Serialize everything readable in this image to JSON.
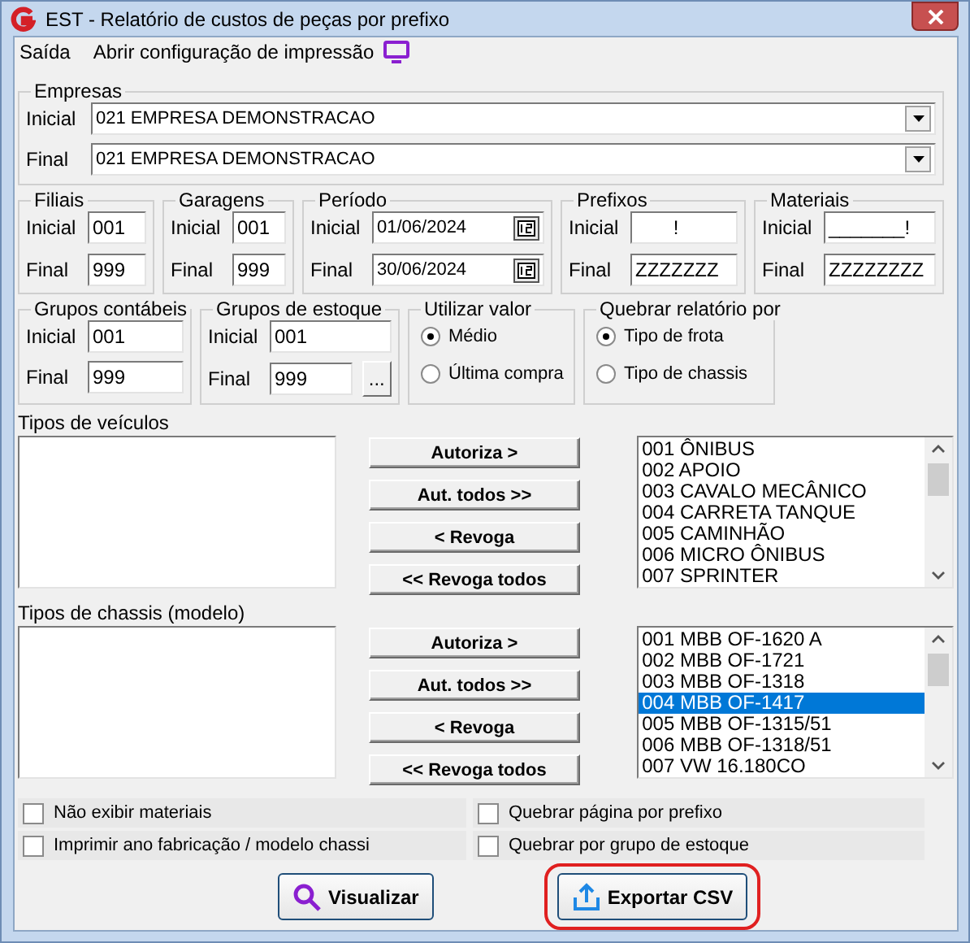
{
  "window": {
    "title": "EST - Relatório de custos de peças por prefixo"
  },
  "menu": [
    {
      "label": "Saída"
    },
    {
      "label": "Abrir configuração de impressão"
    }
  ],
  "empresas": {
    "title": "Empresas",
    "fields": [
      {
        "label": "Inicial",
        "value": "021 EMPRESA DEMONSTRACAO"
      },
      {
        "label": "Final",
        "value": "021 EMPRESA DEMONSTRACAO"
      }
    ]
  },
  "filters_row_1": [
    {
      "kind": "range",
      "title": "Filiais",
      "fields": [
        {
          "label": "Inicial",
          "value": "001",
          "kind": "text"
        },
        {
          "label": "Final",
          "value": "999",
          "kind": "text"
        }
      ]
    },
    {
      "kind": "range",
      "title": "Garagens",
      "fields": [
        {
          "label": "Inicial",
          "value": "001",
          "kind": "text"
        },
        {
          "label": "Final",
          "value": "999",
          "kind": "text"
        }
      ]
    },
    {
      "kind": "range",
      "title": "Período",
      "fields": [
        {
          "label": "Inicial",
          "value": "01/06/2024",
          "kind": "date"
        },
        {
          "label": "Final",
          "value": "30/06/2024",
          "kind": "date"
        }
      ]
    },
    {
      "kind": "range",
      "title": "Prefixos",
      "fields": [
        {
          "label": "Inicial",
          "value": "       !",
          "kind": "text"
        },
        {
          "label": "Final",
          "value": "ZZZZZZZ",
          "kind": "text"
        }
      ]
    },
    {
      "kind": "range",
      "title": "Materiais",
      "fields": [
        {
          "label": "Inicial",
          "value": "_______!",
          "kind": "text"
        },
        {
          "label": "Final",
          "value": "ZZZZZZZZ",
          "kind": "text"
        }
      ]
    }
  ],
  "filters_row_2": [
    {
      "kind": "range",
      "title": "Grupos contábeis",
      "fields": [
        {
          "label": "Inicial",
          "value": "001",
          "kind": "text"
        },
        {
          "label": "Final",
          "value": "999",
          "kind": "text"
        }
      ]
    },
    {
      "kind": "range",
      "title": "Grupos de estoque",
      "fields": [
        {
          "label": "Inicial",
          "value": "001",
          "kind": "text"
        },
        {
          "label": "Final",
          "value": "999",
          "kind": "browse",
          "button": "..."
        }
      ]
    },
    {
      "kind": "radio",
      "title": "Utilizar valor",
      "options": [
        {
          "label": "Médio",
          "selected": true
        },
        {
          "label": "Última compra",
          "selected": false
        }
      ]
    },
    {
      "kind": "radio",
      "title": "Quebrar relatório por",
      "options": [
        {
          "label": "Tipo de frota",
          "selected": true
        },
        {
          "label": "Tipo de chassis",
          "selected": false
        }
      ]
    }
  ],
  "transfers": [
    {
      "title": "Tipos de veículos",
      "buttons": [
        "Autoriza >",
        "Aut. todos >>",
        "< Revoga",
        "<< Revoga todos"
      ],
      "items": [
        {
          "label": "001 ÔNIBUS",
          "selected": false
        },
        {
          "label": "002 APOIO",
          "selected": false
        },
        {
          "label": "003 CAVALO MECÂNICO",
          "selected": false
        },
        {
          "label": "004 CARRETA TANQUE",
          "selected": false
        },
        {
          "label": "005 CAMINHÃO",
          "selected": false
        },
        {
          "label": "006 MICRO ÔNIBUS",
          "selected": false
        },
        {
          "label": "007 SPRINTER",
          "selected": false
        }
      ]
    },
    {
      "title": "Tipos de chassis (modelo)",
      "buttons": [
        "Autoriza >",
        "Aut. todos >>",
        "< Revoga",
        "<< Revoga todos"
      ],
      "items": [
        {
          "label": "001 MBB OF-1620 A",
          "selected": false
        },
        {
          "label": "002 MBB OF-1721",
          "selected": false
        },
        {
          "label": "003 MBB OF-1318",
          "selected": false
        },
        {
          "label": "004 MBB OF-1417",
          "selected": true
        },
        {
          "label": "005 MBB OF-1315/51",
          "selected": false
        },
        {
          "label": "006 MBB OF-1318/51",
          "selected": false
        },
        {
          "label": "007 VW 16.180CO",
          "selected": false
        }
      ]
    }
  ],
  "options_left": [
    {
      "label": "Não exibir materiais",
      "checked": false
    },
    {
      "label": "Imprimir ano fabricação / modelo chassi",
      "checked": false
    }
  ],
  "options_right": [
    {
      "label": "Quebrar página por prefixo",
      "checked": false
    },
    {
      "label": "Quebrar por grupo de estoque",
      "checked": false
    }
  ],
  "actions": [
    {
      "label": "Visualizar",
      "kind": "preview",
      "highlighted": false
    },
    {
      "label": "Exportar CSV",
      "kind": "export",
      "highlighted": true
    }
  ]
}
